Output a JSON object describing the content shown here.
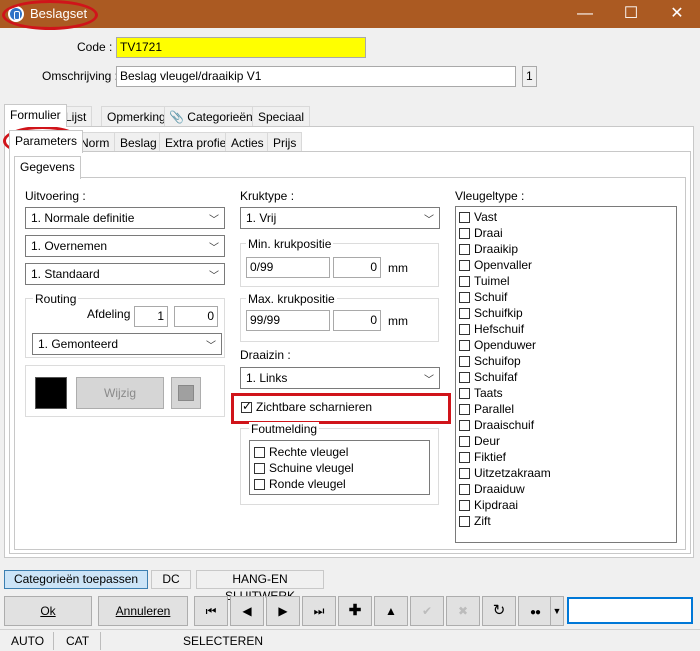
{
  "window": {
    "title": "Beslagset",
    "minimize": "—",
    "maximize": "☐",
    "close": "✕"
  },
  "header": {
    "code_label": "Code :",
    "code_value": "TV1721",
    "omschrijving_label": "Omschrijving :",
    "omschrijving_value": "Beslag vleugel/draaikip V1",
    "count": "1"
  },
  "main_tabs": [
    "Formulier",
    "Lijst",
    "Opmerking",
    "Categorieën",
    "Speciaal"
  ],
  "sub_tabs": [
    "Parameters",
    "Norm",
    "Beslag",
    "Extra profiel",
    "Acties",
    "Prijs"
  ],
  "inner_tab": "Gegevens",
  "uitvoering": {
    "label": "Uitvoering :",
    "combo1": "1.  Normale definitie",
    "combo2": "1.  Overnemen",
    "combo3": "1.  Standaard"
  },
  "routing": {
    "label": "Routing",
    "afdeling_label": "Afdeling :",
    "afdeling_1": "1",
    "afdeling_2": "0",
    "combo": "1.  Gemonteerd"
  },
  "color_box": {
    "wijzig_label": "Wijzig"
  },
  "kruktype": {
    "label": "Kruktype :",
    "combo": "1.  Vrij",
    "min_label": "Min. krukpositie",
    "min_value": "0/99",
    "min_mm": "0",
    "max_label": "Max. krukpositie",
    "max_value": "99/99",
    "max_mm": "0",
    "mm": "mm"
  },
  "draaizin": {
    "label": "Draaizin :",
    "combo": "1.  Links"
  },
  "zichtbare": {
    "label": "Zichtbare scharnieren",
    "checked": true
  },
  "foutmelding": {
    "label": "Foutmelding",
    "items": [
      "Rechte vleugel",
      "Schuine vleugel",
      "Ronde vleugel"
    ]
  },
  "vleugeltype": {
    "label": "Vleugeltype :",
    "items": [
      "Vast",
      "Draai",
      "Draaikip",
      "Openvaller",
      "Tuimel",
      "Schuif",
      "Schuifkip",
      "Hefschuif",
      "Openduwer",
      "Schuifop",
      "Schuifaf",
      "Taats",
      "Parallel",
      "Draaischuif",
      "Deur",
      "Fiktief",
      "Uitzetzakraam",
      "Draaiduw",
      "Kipdraai",
      "Zift"
    ]
  },
  "bottom_tabs": [
    "Categorieën toepassen",
    "DC",
    "HANG-EN SLUITWERK"
  ],
  "buttons": {
    "ok": "Ok",
    "annuleren": "Annuleren"
  },
  "nav_icons": [
    "first-icon",
    "prev-icon",
    "next-icon",
    "last-icon",
    "add-icon",
    "up-icon",
    "confirm-icon",
    "cancel-icon",
    "refresh-icon",
    "binoculars-icon"
  ],
  "status": {
    "a": "AUTO",
    "b": "CAT",
    "c": "SELECTEREN"
  },
  "colors": {
    "titlebar": "#ab5a22",
    "highlight": "#d0141a",
    "code_bg": "#ffff00"
  }
}
